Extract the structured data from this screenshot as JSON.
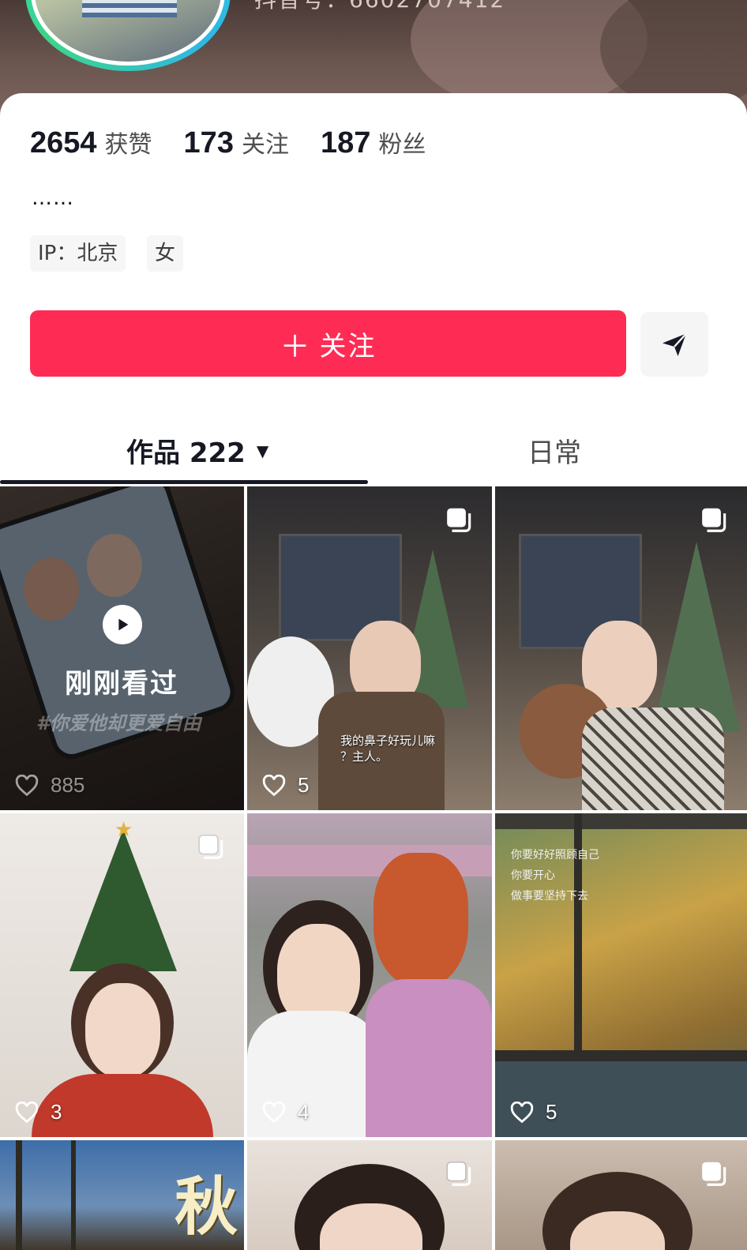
{
  "header": {
    "account_id": "抖音号：6602707412"
  },
  "profile": {
    "stats": [
      {
        "num": "2654",
        "label": "获赞"
      },
      {
        "num": "173",
        "label": "关注"
      },
      {
        "num": "187",
        "label": "粉丝"
      }
    ],
    "bio": "……",
    "tags": [
      "IP：北京",
      "女"
    ],
    "follow_label": "关注",
    "follow_plus": "＋"
  },
  "tabs": {
    "works_label": "作品 222",
    "works_caret": "▼",
    "daily_label": "日常"
  },
  "grid": {
    "watched_label": "刚刚看过",
    "watched_hashtag": "#你爱他却更爱自由",
    "caption_2": "我的鼻子好玩儿嘛\n？主人。",
    "autumn_char": "秋",
    "window_caption": "你要好好照顾自己\n你要开心\n做事要坚持下去",
    "likes": [
      "885",
      "5",
      "",
      "3",
      "4",
      "5"
    ]
  },
  "colors": {
    "accent": "#fe2c55",
    "text": "#161823"
  }
}
